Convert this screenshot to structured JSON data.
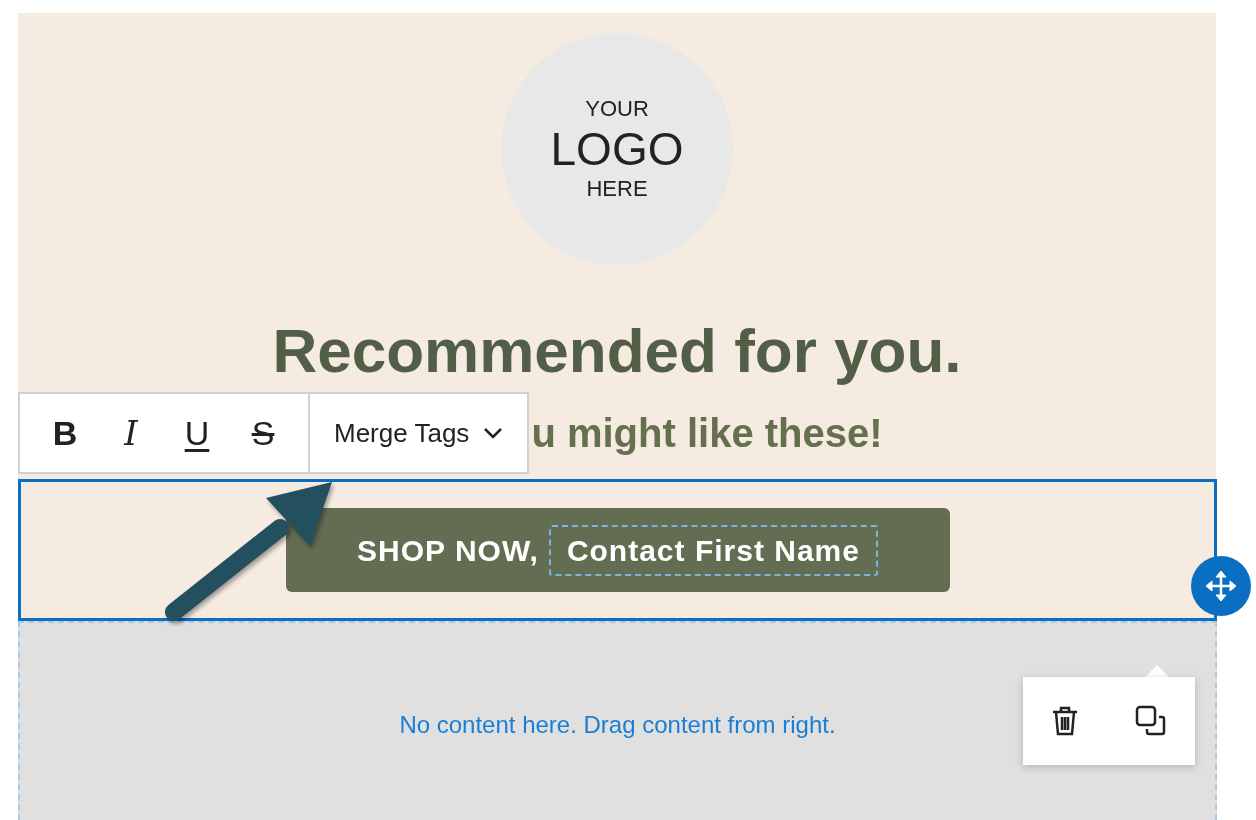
{
  "logo": {
    "lines": [
      "YOUR",
      "LOGO",
      "HERE"
    ]
  },
  "heading": "Recommended for you.",
  "subheading": "u might like these!",
  "toolbar": {
    "format_buttons": [
      {
        "kind": "bold",
        "label": "B"
      },
      {
        "kind": "italic",
        "label": "I"
      },
      {
        "kind": "underline",
        "label": "U"
      },
      {
        "kind": "strike",
        "label": "S"
      }
    ],
    "merge_tags": "Merge Tags"
  },
  "button_block": {
    "selected": true,
    "text": "SHOP NOW,",
    "merge_tag": "Contact First Name"
  },
  "empty_block": {
    "message": "No content here. Drag content from right."
  }
}
